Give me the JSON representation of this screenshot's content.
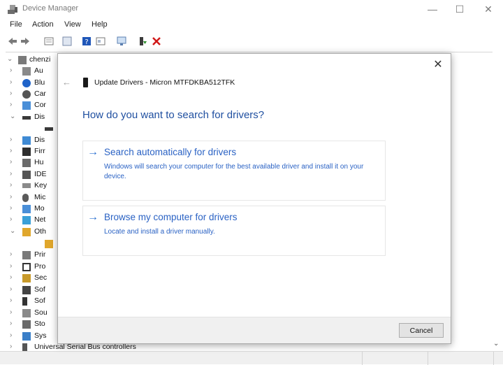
{
  "window": {
    "title": "Device Manager",
    "controls": {
      "minimize": "—",
      "maximize": "☐",
      "close": "✕"
    }
  },
  "menu": [
    "File",
    "Action",
    "View",
    "Help"
  ],
  "toolbar": {
    "icons": [
      "back-arrow-icon",
      "forward-arrow-icon",
      "properties-icon",
      "help-pane-icon",
      "help-icon",
      "show-hidden-icon",
      "scan-hardware-icon",
      "enable-device-icon",
      "uninstall-device-icon"
    ],
    "accent_colors": {
      "help": "#1f56b8",
      "enable": "#2a8c2a",
      "uninstall": "#d01818"
    }
  },
  "tree": {
    "root": "chenzi",
    "items": [
      "Au",
      "Blu",
      "Car",
      "Cor",
      "Dis",
      "",
      "Dis",
      "Firr",
      "Hu",
      "IDE",
      "Key",
      "Mic",
      "Mo",
      "Net",
      "Oth",
      "",
      "Prir",
      "Pro",
      "Sec",
      "Sof",
      "Sof",
      "Sou",
      "Sto",
      "Sys",
      "Universal Serial Bus controllers"
    ]
  },
  "dialog": {
    "close": "✕",
    "back": "←",
    "title": "Update Drivers - Micron MTFDKBA512TFK",
    "heading": "How do you want to search for drivers?",
    "options": [
      {
        "arrow": "→",
        "title": "Search automatically for drivers",
        "description": "Windows will search your computer for the best available driver and install it on your device."
      },
      {
        "arrow": "→",
        "title": "Browse my computer for drivers",
        "description": "Locate and install a driver manually."
      }
    ],
    "cancel": "Cancel"
  }
}
